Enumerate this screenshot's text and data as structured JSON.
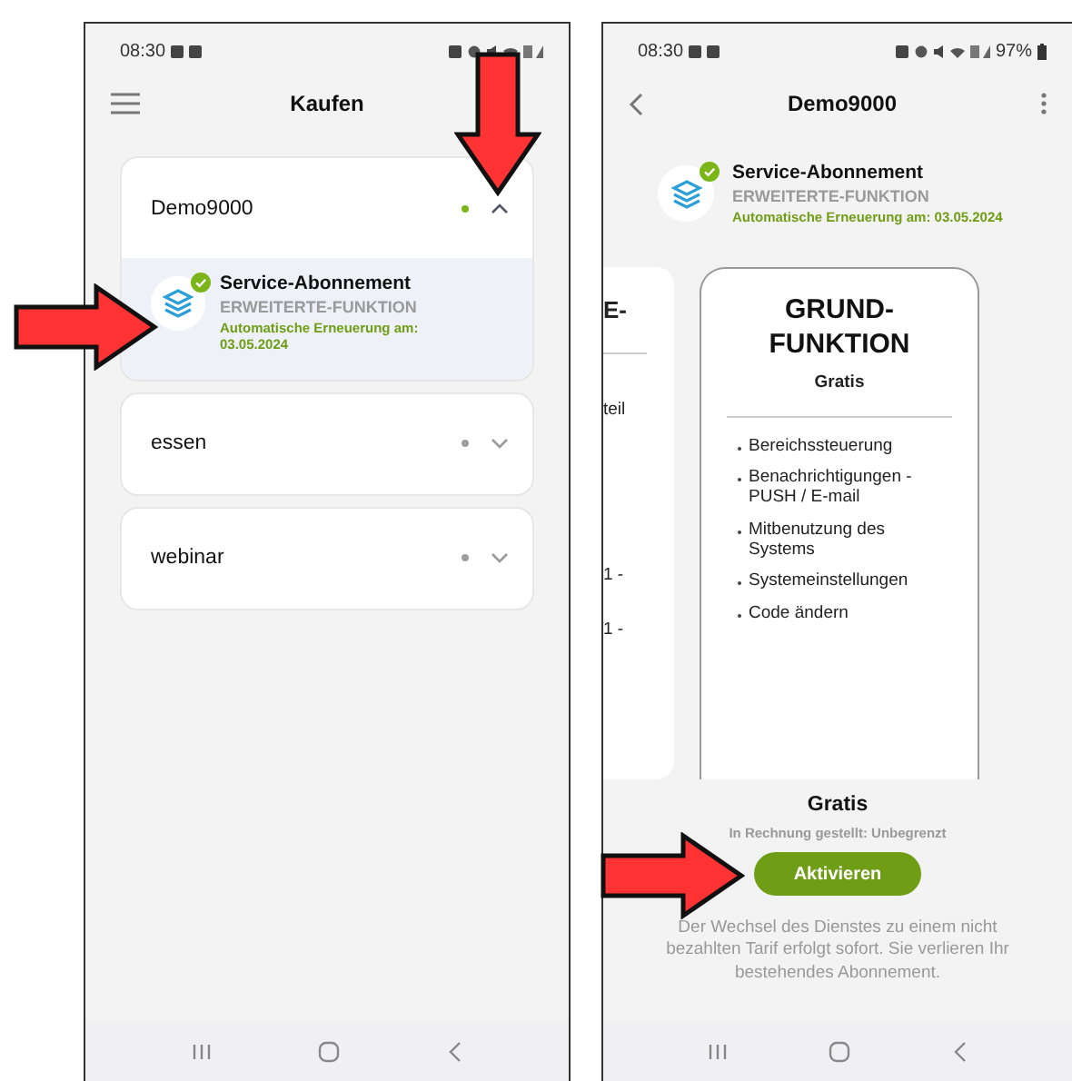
{
  "purchase_screen": {
    "status_bar": {
      "time": "08:30"
    },
    "header": {
      "title": "Kaufen"
    },
    "accounts": [
      {
        "name": "Demo9000",
        "expanded": true,
        "color": "#7cb518",
        "subscription": {
          "title": "Service-Abonnement",
          "tier": "ERWEITERTE-FUNKTION",
          "renewal": "Automatische Erneuerung am: 03.05.2024",
          "active": true
        }
      },
      {
        "name": "essen",
        "expanded": false,
        "color": "#9e9e9e"
      },
      {
        "name": "webinar",
        "expanded": false,
        "color": "#9e9e9e"
      }
    ]
  },
  "plan_screen": {
    "status_bar": {
      "time": "08:30",
      "battery": "97%"
    },
    "header": {
      "title": "Demo9000"
    },
    "subscription": {
      "title": "Service-Abonnement",
      "tier": "ERWEITERTE-FUNKTION",
      "renewal": "Automatische Erneuerung am: 03.05.2024",
      "active": true
    },
    "previous_plan_fragments": [
      "E-",
      "teil",
      "1 -",
      "1 -"
    ],
    "plan": {
      "title": "GRUND-\nFUNKTION",
      "price": "Gratis",
      "features": [
        "Bereichssteuerung",
        "Benachrichtigungen - PUSH / E-mail",
        "Mitbenutzung des Systems",
        "Systemeinstellungen",
        "Code ändern"
      ]
    },
    "footer": {
      "price": "Gratis",
      "billing": "In Rechnung gestellt: Unbegrenzt",
      "button": "Aktivieren",
      "note": "Der Wechsel des Dienstes zu einem nicht bezahlten Tarif erfolgt sofort. Sie verlieren Ihr bestehendes Abonnement."
    }
  }
}
